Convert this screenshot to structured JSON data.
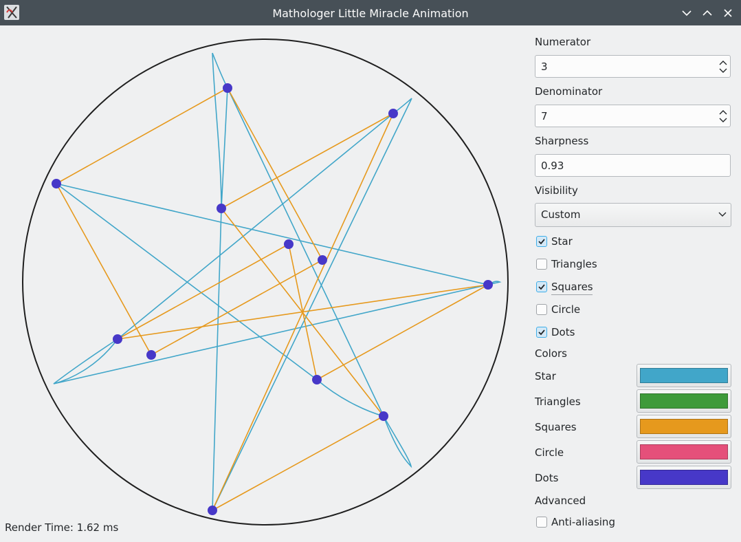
{
  "window": {
    "title": "Mathologer Little Miracle Animation",
    "icons": [
      "app-icon",
      "minimize-icon",
      "maximize-icon",
      "close-icon"
    ]
  },
  "canvas": {
    "render_time": "Render Time: 1.62 ms"
  },
  "controls": {
    "numerator": {
      "label": "Numerator",
      "value": "3"
    },
    "denominator": {
      "label": "Denominator",
      "value": "7"
    },
    "sharpness": {
      "label": "Sharpness",
      "value": "0.93"
    },
    "visibility": {
      "label": "Visibility",
      "selected": "Custom"
    },
    "checkboxes": [
      {
        "label": "Star",
        "checked": true
      },
      {
        "label": "Triangles",
        "checked": false
      },
      {
        "label": "Squares",
        "checked": true
      },
      {
        "label": "Circle",
        "checked": false
      },
      {
        "label": "Dots",
        "checked": true
      }
    ],
    "colors_heading": "Colors",
    "colors": [
      {
        "label": "Star",
        "color": "#41a6c9"
      },
      {
        "label": "Triangles",
        "color": "#3e9a3a"
      },
      {
        "label": "Squares",
        "color": "#e6991d"
      },
      {
        "label": "Circle",
        "color": "#e5507a"
      },
      {
        "label": "Dots",
        "color": "#4738c8"
      }
    ],
    "advanced_heading": "Advanced",
    "antialiasing": {
      "label": "Anti-aliasing",
      "checked": false
    }
  },
  "theme": {
    "circle_color": "#1f1f1f",
    "titlebar": "#475057"
  }
}
